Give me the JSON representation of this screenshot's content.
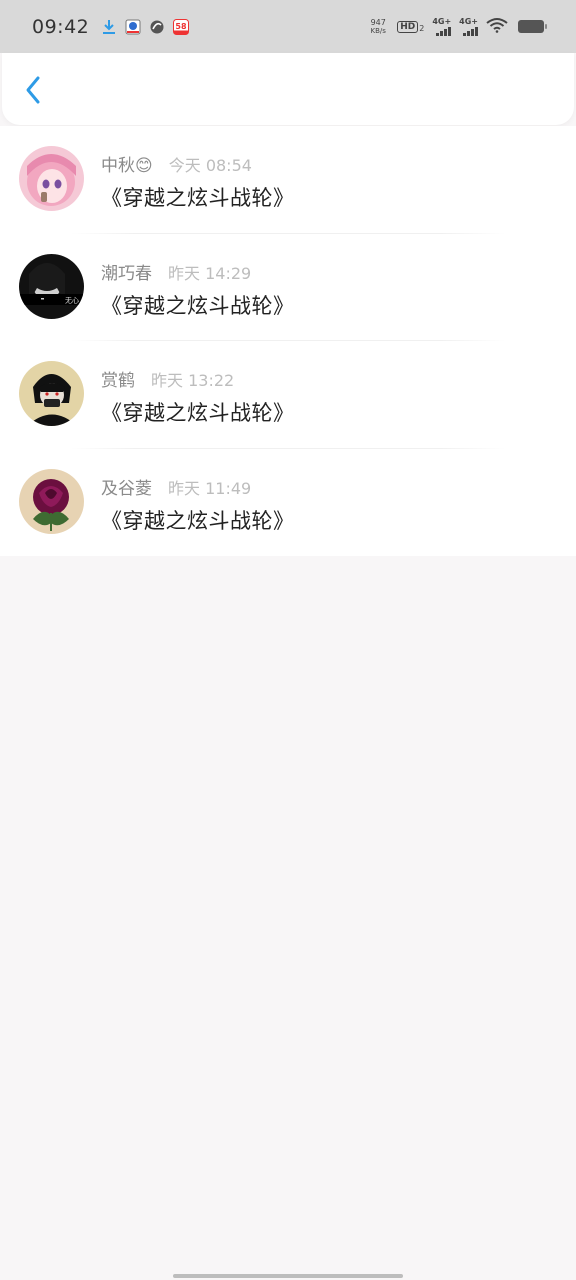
{
  "status_bar": {
    "time": "09:42",
    "net_speed_value": "947",
    "net_speed_unit": "KB/s",
    "hd_label": "HD",
    "hd_sub": "2",
    "signal1_label": "4G+",
    "signal2_label": "4G+"
  },
  "header": {
    "back_icon": "chevron-left-icon",
    "accent_color": "#2e9be6"
  },
  "items": [
    {
      "name": "中秋😊",
      "time": "今天 08:54",
      "message": "《穿越之炫斗战轮》"
    },
    {
      "name": "潮巧春",
      "time": "昨天 14:29",
      "message": "《穿越之炫斗战轮》",
      "avatar_caption": "无心"
    },
    {
      "name": "赏鹤",
      "time": "昨天 13:22",
      "message": "《穿越之炫斗战轮》"
    },
    {
      "name": "及谷菱",
      "time": "昨天 11:49",
      "message": "《穿越之炫斗战轮》"
    }
  ]
}
